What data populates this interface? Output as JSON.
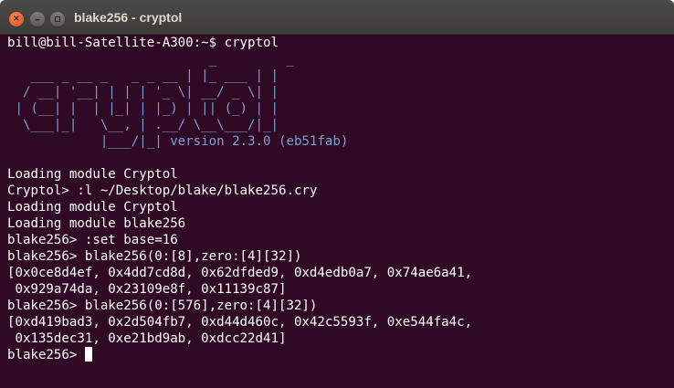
{
  "window": {
    "title": "blake256 - cryptol",
    "buttons": {
      "close": "×",
      "minimize": "–"
    }
  },
  "terminal": {
    "shell_prompt": "bill@bill-Satellite-A300:~$ cryptol",
    "banner_lines": [
      "                          _         _",
      "   ___ _ __ _   _ _ __ | |_ ___ | |",
      "  / __| '__| | | | '_ \\| __/ _ \\| |",
      " | (__| |  | |_| | |_) | || (_) | |",
      "  \\___|_|   \\__, | .__/ \\__\\___/|_|",
      "            |___/|_|"
    ],
    "version": " version 2.3.0 (eb51fab)",
    "output_lines": [
      "",
      "Loading module Cryptol",
      "Cryptol> :l ~/Desktop/blake/blake256.cry",
      "Loading module Cryptol",
      "Loading module blake256",
      "blake256> :set base=16",
      "blake256> blake256(0:[8],zero:[4][32])",
      "[0x0ce8d4ef, 0x4dd7cd8d, 0x62dfded9, 0xd4edb0a7, 0x74ae6a41,",
      " 0x929a74da, 0x23109e8f, 0x11139c87]",
      "blake256> blake256(0:[576],zero:[4][32])",
      "[0xd419bad3, 0x2d504fb7, 0xd44d460c, 0x42c5593f, 0xe544fa4c,",
      " 0x135dec31, 0xe21bd9ab, 0xdcc22d41]"
    ],
    "final_prompt": "blake256> "
  },
  "colors": {
    "background": "#300a24",
    "banner": "#7e9dd4",
    "text": "#ffffff"
  }
}
